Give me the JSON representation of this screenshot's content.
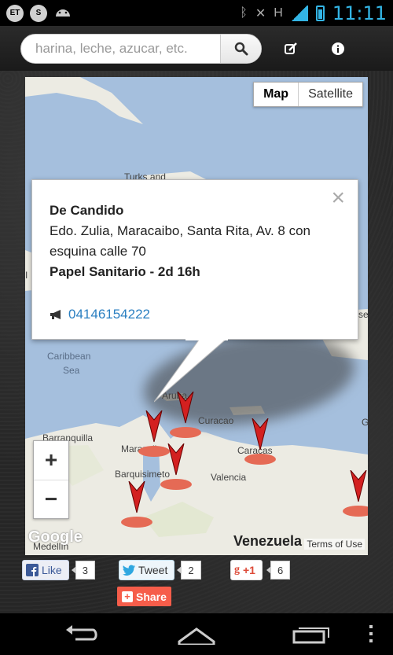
{
  "status_bar": {
    "left_icons": [
      "ET",
      "S"
    ],
    "network": "H",
    "time": "11:11"
  },
  "toolbar": {
    "search_placeholder": "harina, leche, azucar, etc.",
    "icons": [
      "search-icon",
      "edit-icon",
      "info-icon"
    ]
  },
  "map": {
    "map_type": {
      "map": "Map",
      "satellite": "Satellite",
      "selected": "Map"
    },
    "labels": {
      "turks": "Turks and",
      "caribbean": "Caribbean",
      "sea": "Sea",
      "aruba": "Aruba",
      "curacao": "Curacao",
      "barranquilla": "Barranquilla",
      "maracaibo": "Maracaibo",
      "caracas": "Caracas",
      "barquisimeto": "Barquisimeto",
      "valencia": "Valencia",
      "medellin": "Medellín",
      "venezuela": "Venezuela",
      "left_edge": "I",
      "right_edge_1": "se",
      "right_edge_2": "G"
    },
    "zoom_in": "+",
    "zoom_out": "−",
    "attribution_logo": "Google",
    "terms": "Terms of Use"
  },
  "info_window": {
    "name": "De Candido",
    "address": "Edo. Zulia, Maracaibo, Santa Rita, Av. 8 con esquina calle 70",
    "product": "Papel Sanitario - 2d 16h",
    "phone": "04146154222",
    "close": "×"
  },
  "social": {
    "facebook": {
      "label": "Like",
      "count": "3"
    },
    "twitter": {
      "label": "Tweet",
      "count": "2"
    },
    "gplus": {
      "label": "+1",
      "count": "6"
    },
    "share": {
      "label": "Share"
    }
  },
  "colors": {
    "accent": "#33b5e5",
    "link": "#2a7fc1",
    "share": "#f65d4a",
    "water": "#a5bfdd",
    "land": "#ecebe3"
  }
}
